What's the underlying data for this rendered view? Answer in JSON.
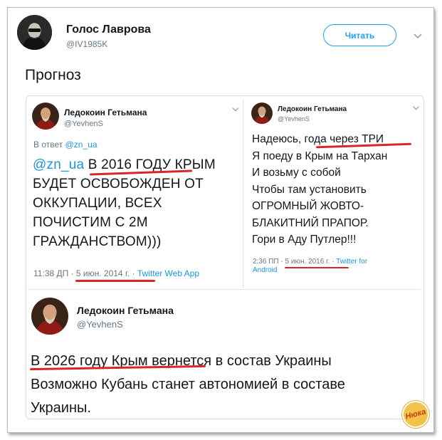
{
  "main_tweet": {
    "author_name": "Голос Лаврова",
    "author_handle": "@IV1985K",
    "follow_label": "Читать",
    "text": "Прогноз"
  },
  "quoted_left": {
    "author_name": "Ледокоин Гетьмана",
    "author_handle": "@YevhenS",
    "reply_prefix": "В ответ",
    "reply_handle": "@zn_ua",
    "mention": "@zn_ua",
    "lines": [
      "В 2016 ГОДУ КРЫМ",
      "БУДЕТ ОСВОБОЖДЕН ОТ",
      "ОККУПАЦИИ, ВСЕХ",
      "ПОЧИСТИМ С 2М",
      "ГРАЖДАНСТВОМ)))"
    ],
    "time": "11:38 ДП",
    "date": "5 июн. 2014 г.",
    "source": "Twitter Web App"
  },
  "quoted_right": {
    "author_name": "Ледокоин Гетьмана",
    "author_handle": "@YevhenS",
    "lines": [
      "Надеюсь, года через ТРИ",
      "Я поеду в Крым на Тархан",
      "И возьму с собой",
      "Чтобы там установить",
      "ОГРОМНЫЙ ЖОВТО-",
      "БЛАКИТНИЙ ПРАПОР.",
      "Гори в Аду Путлер!!!"
    ],
    "time": "2:36 ПП",
    "date": "5 июн. 2016 г.",
    "source_line1": "Twitter for",
    "source_line2": "Android"
  },
  "bottom_tweet": {
    "author_name": "Ледокоин Гетьмана",
    "author_handle": "@YevhenS",
    "lines": [
      "В 2026 году Крым вернется в состав Украины",
      "Возможно Кубань станет автономией в составе",
      "Украины."
    ]
  },
  "watermark": {
    "text": "Нюка"
  },
  "colors": {
    "link": "#1b95e0",
    "follow": "#1da1f2",
    "highlight": "#d8262b"
  }
}
